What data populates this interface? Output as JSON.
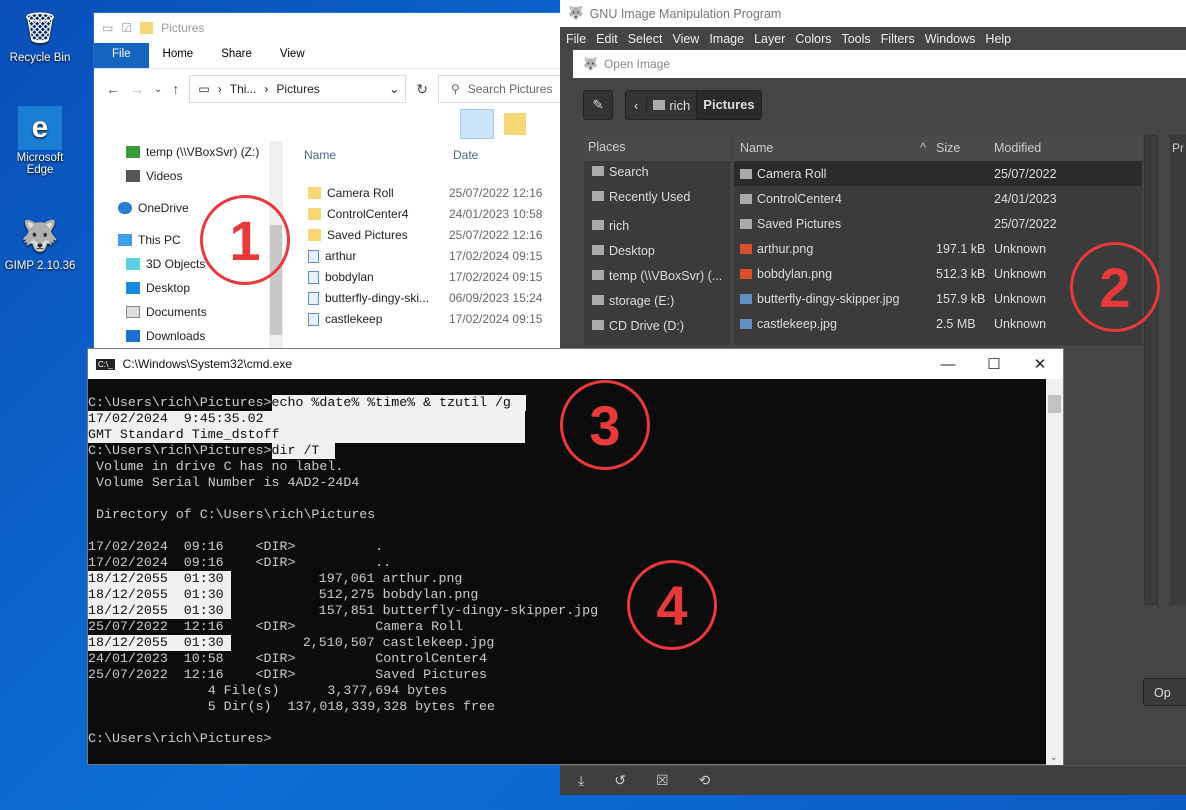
{
  "desktop": {
    "icons": [
      {
        "label": "Recycle Bin",
        "icon": "recycle-bin-icon"
      },
      {
        "label": "Microsoft Edge",
        "icon": "edge-icon"
      },
      {
        "label": "GIMP 2.10.36",
        "icon": "gimp-icon"
      }
    ]
  },
  "explorer": {
    "title": "Pictures",
    "tabs": [
      "File",
      "Home",
      "Share",
      "View"
    ],
    "address": [
      "Thi...",
      "Pictures"
    ],
    "search_placeholder": "Search Pictures",
    "nav": [
      "temp (\\\\VBoxSvr) (Z:)",
      "Videos",
      "OneDrive",
      "This PC",
      "3D Objects",
      "Desktop",
      "Documents",
      "Downloads"
    ],
    "columns": [
      "Name",
      "Date"
    ],
    "files": [
      {
        "name": "Camera Roll",
        "date": "25/07/2022 12:16",
        "type": "folder"
      },
      {
        "name": "ControlCenter4",
        "date": "24/01/2023 10:58",
        "type": "folder"
      },
      {
        "name": "Saved Pictures",
        "date": "25/07/2022 12:16",
        "type": "folder"
      },
      {
        "name": "arthur",
        "date": "17/02/2024 09:15",
        "type": "image"
      },
      {
        "name": "bobdylan",
        "date": "17/02/2024 09:15",
        "type": "image"
      },
      {
        "name": "butterfly-dingy-ski...",
        "date": "06/09/2023 15:24",
        "type": "image"
      },
      {
        "name": "castlekeep",
        "date": "17/02/2024 09:15",
        "type": "image"
      }
    ]
  },
  "gimp": {
    "title": "GNU Image Manipulation Program",
    "menu": [
      "File",
      "Edit",
      "Select",
      "View",
      "Image",
      "Layer",
      "Colors",
      "Tools",
      "Filters",
      "Windows",
      "Help"
    ],
    "dialog": {
      "title": "Open Image",
      "crumbs": [
        "rich",
        "Pictures"
      ],
      "places_header": "Places",
      "places": [
        "Search",
        "Recently Used",
        "rich",
        "Desktop",
        "temp (\\\\VBoxSvr) (...",
        "storage (E:)",
        "CD Drive (D:)"
      ],
      "columns": [
        "Name",
        "Size",
        "Modified"
      ],
      "preview_label": "Pr",
      "open_label": "Op",
      "files": [
        {
          "name": "Camera Roll",
          "size": "",
          "modified": "25/07/2022",
          "type": "folder"
        },
        {
          "name": "ControlCenter4",
          "size": "",
          "modified": "24/01/2023",
          "type": "folder"
        },
        {
          "name": "Saved Pictures",
          "size": "",
          "modified": "25/07/2022",
          "type": "folder"
        },
        {
          "name": "arthur.png",
          "size": "197.1 kB",
          "modified": "Unknown",
          "type": "png"
        },
        {
          "name": "bobdylan.png",
          "size": "512.3 kB",
          "modified": "Unknown",
          "type": "png"
        },
        {
          "name": "butterfly-dingy-skipper.jpg",
          "size": "157.9 kB",
          "modified": "Unknown",
          "type": "jpg"
        },
        {
          "name": "castlekeep.jpg",
          "size": "2.5 MB",
          "modified": "Unknown",
          "type": "jpg"
        }
      ]
    }
  },
  "cmd": {
    "title": "C:\\Windows\\System32\\cmd.exe",
    "lines": [
      {
        "a": "",
        "s": "",
        "b": ""
      },
      {
        "a": "C:\\Users\\rich\\Pictures>",
        "s": "echo %date% %time% & tzutil /g",
        "w": "w1",
        "b": ""
      },
      {
        "a": "",
        "s": "17/02/2024  9:45:35.02",
        "w": "w2",
        "b": ""
      },
      {
        "a": "",
        "s": "GMT Standard Time_dstoff",
        "w": "w2",
        "b": ""
      },
      {
        "a": "C:\\Users\\rich\\Pictures>",
        "s": "dir /T",
        "w": "w3",
        "b": ""
      },
      {
        "a": " Volume in drive C has no label.",
        "s": "",
        "b": ""
      },
      {
        "a": " Volume Serial Number is 4AD2-24D4",
        "s": "",
        "b": ""
      },
      {
        "a": "",
        "s": "",
        "b": ""
      },
      {
        "a": " Directory of C:\\Users\\rich\\Pictures",
        "s": "",
        "b": ""
      },
      {
        "a": "",
        "s": "",
        "b": ""
      },
      {
        "a": "17/02/2024  09:16    <DIR>          .",
        "s": "",
        "b": ""
      },
      {
        "a": "17/02/2024  09:16    <DIR>          ..",
        "s": "",
        "b": ""
      },
      {
        "a": "",
        "s": "18/12/2055  01:30",
        "w": "w4",
        "b": "           197,061 arthur.png"
      },
      {
        "a": "",
        "s": "18/12/2055  01:30",
        "w": "w4",
        "b": "           512,275 bobdylan.png"
      },
      {
        "a": "",
        "s": "18/12/2055  01:30",
        "w": "w4",
        "b": "           157,851 butterfly-dingy-skipper.jpg"
      },
      {
        "a": "25/07/2022  12:16    <DIR>          Camera Roll",
        "s": "",
        "b": ""
      },
      {
        "a": "",
        "s": "18/12/2055  01:30",
        "w": "w4",
        "b": "         2,510,507 castlekeep.jpg"
      },
      {
        "a": "24/01/2023  10:58    <DIR>          ControlCenter4",
        "s": "",
        "b": ""
      },
      {
        "a": "25/07/2022  12:16    <DIR>          Saved Pictures",
        "s": "",
        "b": ""
      },
      {
        "a": "               4 File(s)      3,377,694 bytes",
        "s": "",
        "b": ""
      },
      {
        "a": "               5 Dir(s)  137,018,339,328 bytes free",
        "s": "",
        "b": ""
      },
      {
        "a": "",
        "s": "",
        "b": ""
      },
      {
        "a": "C:\\Users\\rich\\Pictures>",
        "s": "",
        "b": ""
      }
    ]
  },
  "annotations": [
    "1",
    "2",
    "3",
    "4"
  ],
  "colors": {
    "annotation": "#e83a3a",
    "gimp_bg": "#454545",
    "cmd_bg": "#0c0c0c"
  }
}
